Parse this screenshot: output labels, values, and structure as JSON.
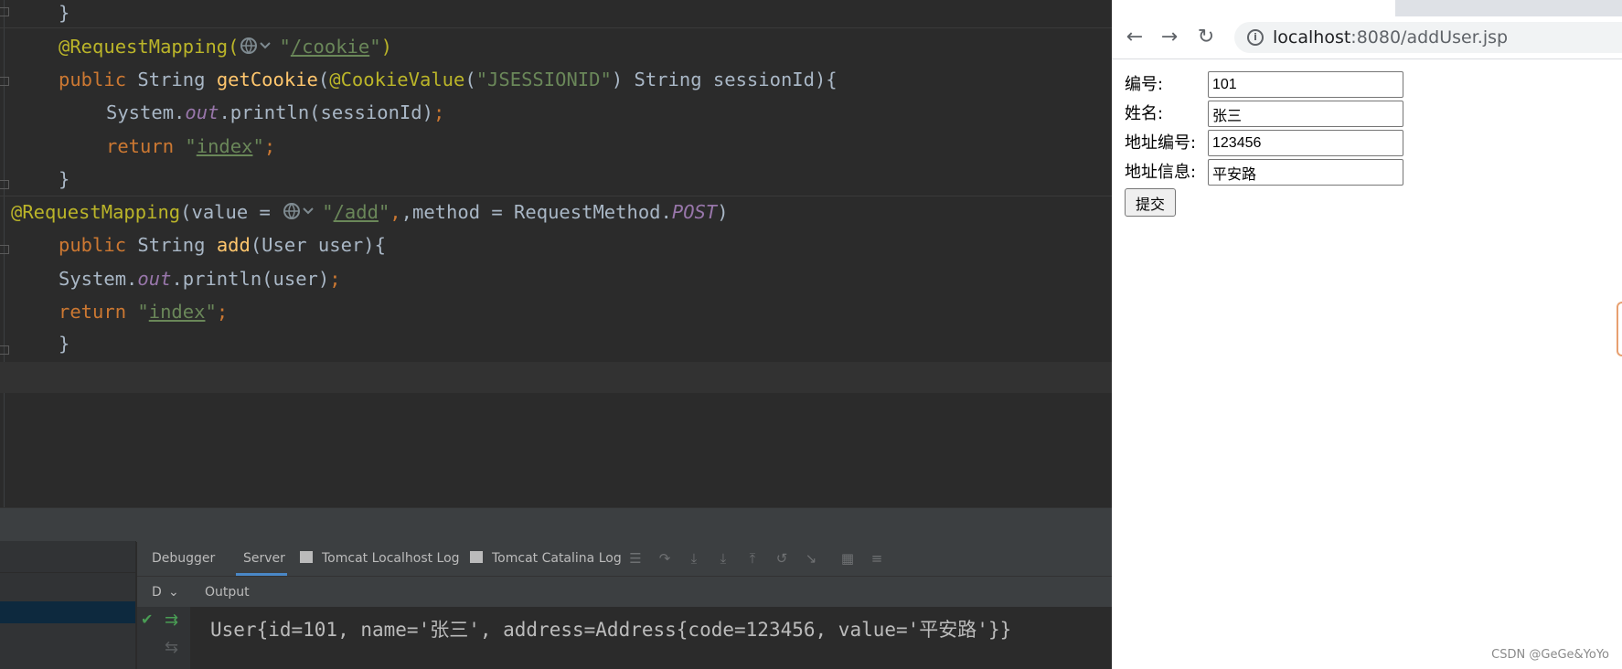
{
  "editor": {
    "line1": "}",
    "line2_ann": "@RequestMapping(",
    "line2_path": "/cookie",
    "line2_end": "\")",
    "line3_kw": "public",
    "line3_type": " String ",
    "line3_fn": "getCookie",
    "line3_ann": "@CookieValue",
    "line3_str": "\"JSESSIONID\"",
    "line3_rest": ") String sessionId){",
    "line4_pre": "System.",
    "line4_out": "out",
    "line4_rest": ".println(sessionId)",
    "line4_semi": ";",
    "line5_kw": "return",
    "line5_str": "index",
    "line5_semi": ";",
    "line6": "}",
    "line7_ann": "@RequestMapping",
    "line7_mid": "(value = ",
    "line7_path": "/add",
    "line7_rest": ",method = RequestMethod.",
    "line7_post": "POST",
    "line7_close": ")",
    "line8_kw": "public",
    "line8_type": " String ",
    "line8_fn": "add",
    "line8_rest": "(User user){",
    "line9_pre": "System.",
    "line9_out": "out",
    "line9_rest": ".println(user)",
    "line9_semi": ";",
    "line10_kw": "return",
    "line10_str": "index",
    "line10_semi": ";",
    "line11": "}"
  },
  "panel": {
    "tabs": [
      "Debugger",
      "Server",
      "Tomcat Localhost Log",
      "Tomcat Catalina Log"
    ],
    "subheader_left": "D",
    "output_label": "Output",
    "output_text": "User{id=101, name='张三', address=Address{code=123456, value='平安路'}}"
  },
  "browser": {
    "url_host": "localhost",
    "url_rest": ":8080/addUser.jsp",
    "form": {
      "fields": [
        {
          "label": "编号:",
          "value": "101"
        },
        {
          "label": "姓名:",
          "value": "张三"
        },
        {
          "label": "地址编号:",
          "value": "123456"
        },
        {
          "label": "地址信息:",
          "value": "平安路"
        }
      ],
      "submit_label": "提交"
    },
    "watermark": "CSDN @GeGe&YoYo"
  },
  "colors": {
    "annotation": "#bbb529",
    "keyword": "#cc7832",
    "function": "#ffc66d",
    "string": "#6a8759",
    "static_field": "#9876aa"
  }
}
